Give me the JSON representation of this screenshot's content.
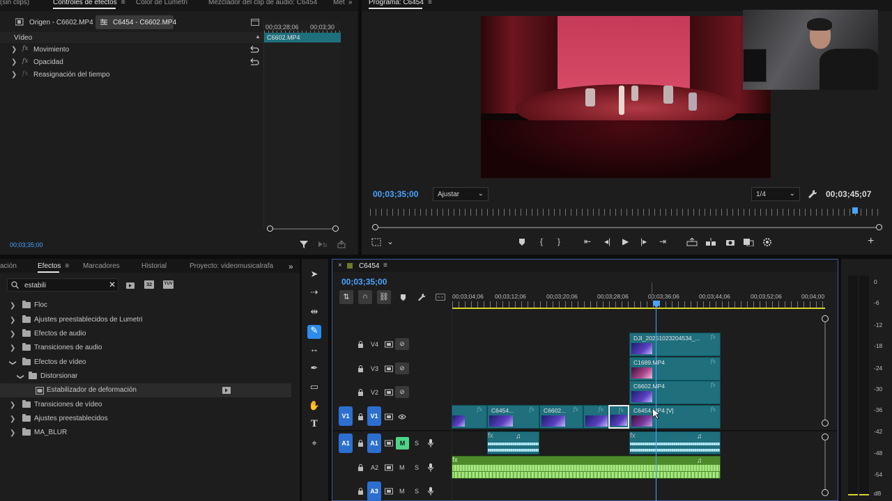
{
  "top_tabs_left": {
    "t0": "(sin clips)",
    "t1": "Controles de efectos",
    "t2": "Color de Lumetri",
    "t3": "Mezclador del clip de audio: C6454",
    "t4": "Met"
  },
  "program": {
    "tab": "Programa: C6454",
    "timecode_current": "00;03;35;00",
    "fit": "Ajustar",
    "resolution": "1/4",
    "timecode_duration": "00;03;45;07"
  },
  "effect_controls": {
    "sub_tab_source": "Origen - C6602.MP4",
    "sub_tab_seq": "C6454 - C6602.MP4",
    "section": "Vídeo",
    "items": [
      {
        "label": "Movimiento"
      },
      {
        "label": "Opacidad"
      },
      {
        "label": "Reasignación del tiempo"
      }
    ],
    "mini_ruler_1": "00;03;28;06",
    "mini_ruler_2": "00;03;30",
    "mini_clip": "C6602.MP4",
    "timecode": "00;03;35;00",
    "fx_symbol": "fx"
  },
  "effects_panel": {
    "tab_left": "ación",
    "tab_active": "Efectos",
    "tab_markers": "Marcadores",
    "tab_history": "Historial",
    "tab_project": "Proyecto: videomusicalrafa",
    "search_value": "estabili",
    "badge_32": "32",
    "badge_yuv": "YUV",
    "tree": [
      {
        "label": "Floc"
      },
      {
        "label": "Ajustes preestablecidos de Lumetri"
      },
      {
        "label": "Efectos de audio"
      },
      {
        "label": "Transiciones de audio"
      },
      {
        "label": "Efectos de vídeo"
      },
      {
        "label": "Distorsionar"
      },
      {
        "label": "Estabilizador de deformación"
      },
      {
        "label": "Transiciones de vídeo"
      },
      {
        "label": "Ajustes preestablecidos"
      },
      {
        "label": "MA_BLUR"
      }
    ]
  },
  "timeline": {
    "sequence_name": "C6454",
    "timecode": "00;03;35;00",
    "ruler": [
      "00;03;04;06",
      "00;03;12;06",
      "00;03;20;06",
      "00;03;28;06",
      "00;03;36;06",
      "00;03;44;06",
      "00;03;52;06",
      "00;04;00"
    ],
    "tracks": {
      "v4": "V4",
      "v3": "V3",
      "v2": "V2",
      "v1": "V1",
      "a1": "A1",
      "a2": "A2",
      "a3": "A3",
      "m": "M",
      "s": "S"
    },
    "clips": {
      "v4": "DJI_20251023204534_...",
      "v3": "C1689.MP4",
      "v2": "C6602.MP4",
      "v1_a": "C6454...",
      "v1_b": "C6602...",
      "v1_main": "C6454.MP4 [V]"
    }
  },
  "meter": {
    "labels": [
      "0",
      "-6",
      "-12",
      "-18",
      "-24",
      "-30",
      "-36",
      "-42",
      "-48",
      "-54",
      "dB"
    ]
  }
}
